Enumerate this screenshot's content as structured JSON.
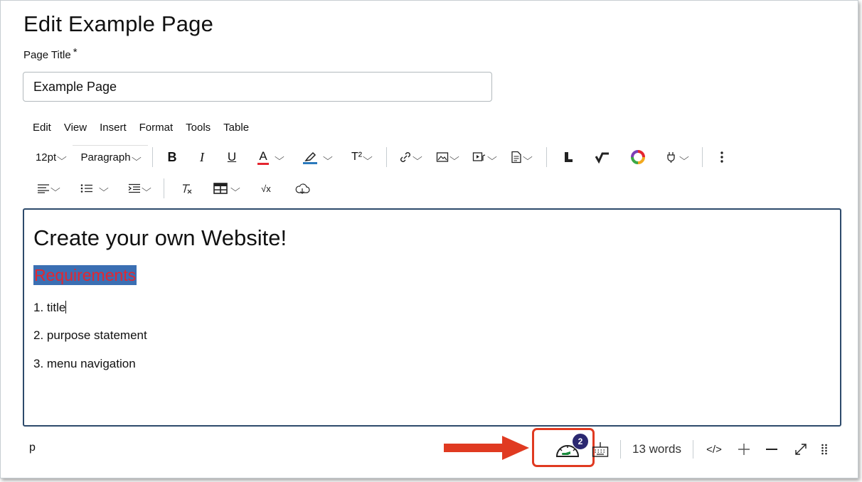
{
  "page": {
    "heading": "Edit Example Page",
    "title_label": "Page Title",
    "required_marker": "*",
    "title_value": "Example Page"
  },
  "menubar": [
    "Edit",
    "View",
    "Insert",
    "Format",
    "Tools",
    "Table"
  ],
  "toolbar": {
    "font_size": "12pt",
    "block_format": "Paragraph",
    "superscript_label": "T²",
    "math_label": "√x",
    "icons": [
      "bold-icon",
      "italic-icon",
      "underline-icon",
      "text-color-icon",
      "highlight-icon",
      "superscript-icon",
      "link-icon",
      "image-icon",
      "media-icon",
      "document-icon",
      "plugin-icon",
      "checkmark-icon",
      "color-ring-icon",
      "apps-icon",
      "more-icon",
      "align-icon",
      "bullet-list-icon",
      "indent-icon",
      "clear-format-icon",
      "table-icon",
      "math-icon",
      "cloud-icon"
    ]
  },
  "editor": {
    "heading": "Create your own Website!",
    "subheading": "Requirements",
    "lines": [
      "1. title",
      "2. purpose statement",
      "3. menu navigation"
    ]
  },
  "statusbar": {
    "element_path": "p",
    "accessibility_issue_count": "2",
    "word_count": "13 words",
    "html_toggle": "</>"
  },
  "colors": {
    "text_color_underline": "#e4262f",
    "highlight_underline": "#2b7abc",
    "editor_border": "#2d4a6b",
    "subheading_text": "#e4262f",
    "subheading_highlight": "#3b6fb3",
    "badge_bg": "#2b2870",
    "callout": "#e03a21"
  }
}
